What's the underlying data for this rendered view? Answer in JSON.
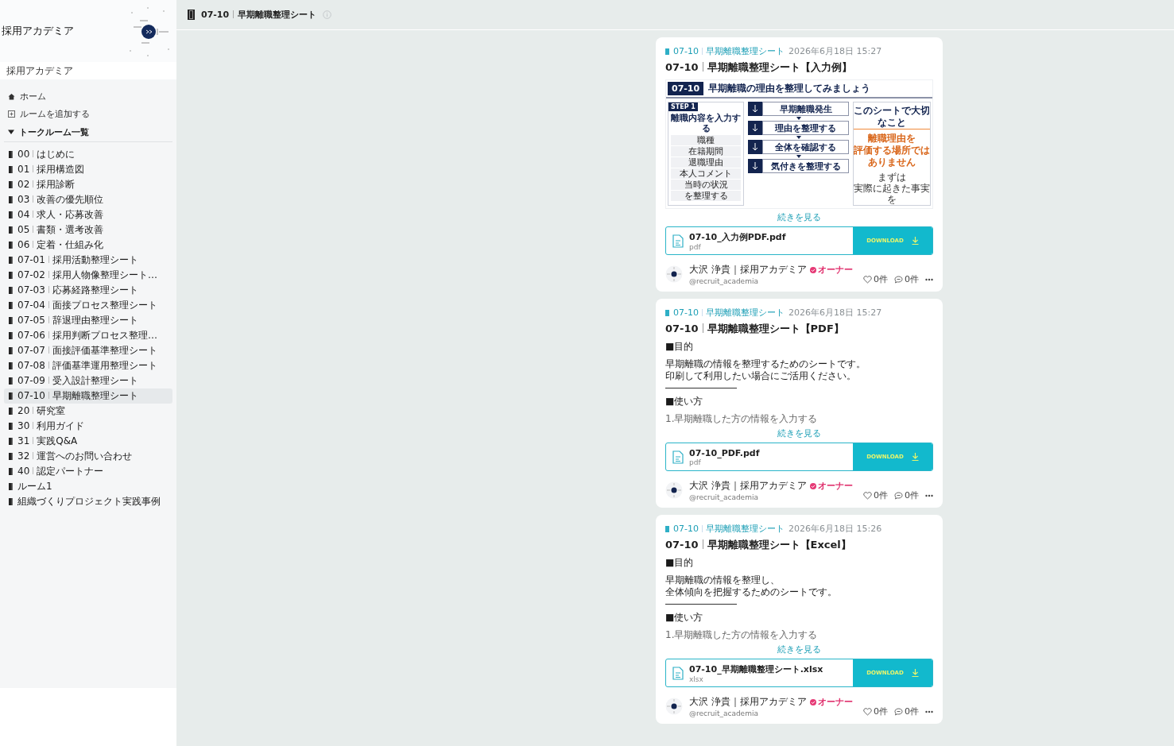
{
  "sidebar": {
    "banner_title": "採用アカデミア",
    "community_name": "採用アカデミア",
    "nav": [
      {
        "kind": "home",
        "label": "ホーム"
      },
      {
        "kind": "add",
        "label": "ルームを追加する"
      }
    ],
    "rooms_section": {
      "label": "トークルーム一覧",
      "expanded": true
    },
    "rooms": [
      {
        "number": "00",
        "name": "はじめに",
        "selected": false
      },
      {
        "number": "01",
        "name": "採用構造図",
        "selected": false
      },
      {
        "number": "02",
        "name": "採用診断",
        "selected": false
      },
      {
        "number": "03",
        "name": "改善の優先順位",
        "selected": false
      },
      {
        "number": "04",
        "name": "求人・応募改善",
        "selected": false
      },
      {
        "number": "05",
        "name": "書類・選考改善",
        "selected": false
      },
      {
        "number": "06",
        "name": "定着・仕組み化",
        "selected": false
      },
      {
        "number": "07-01",
        "name": "採用活動整理シート",
        "selected": false
      },
      {
        "number": "07-02",
        "name": "採用人物像整理シート…",
        "selected": false
      },
      {
        "number": "07-03",
        "name": "応募経路整理シート",
        "selected": false
      },
      {
        "number": "07-04",
        "name": "面接プロセス整理シート",
        "selected": false
      },
      {
        "number": "07-05",
        "name": "辞退理由整理シート",
        "selected": false
      },
      {
        "number": "07-06",
        "name": "採用判断プロセス整理…",
        "selected": false
      },
      {
        "number": "07-07",
        "name": "面接評価基準整理シート",
        "selected": false
      },
      {
        "number": "07-08",
        "name": "評価基準運用整理シート",
        "selected": false
      },
      {
        "number": "07-09",
        "name": "受入設計整理シート",
        "selected": false
      },
      {
        "number": "07-10",
        "name": "早期離職整理シート",
        "selected": true
      },
      {
        "number": "20",
        "name": "研究室",
        "selected": false
      },
      {
        "number": "30",
        "name": "利用ガイド",
        "selected": false
      },
      {
        "number": "31",
        "name": "実践Q&A",
        "selected": false
      },
      {
        "number": "32",
        "name": "運営へのお問い合わせ",
        "selected": false
      },
      {
        "number": "40",
        "name": "認定パートナー",
        "selected": false
      },
      {
        "name": "ルーム1",
        "selected": false
      },
      {
        "name": "組織づくりプロジェクト実践事例",
        "selected": false
      }
    ]
  },
  "header": {
    "number": "07-10",
    "name": "早期離職整理シート"
  },
  "posts": [
    {
      "room_number": "07-10",
      "room_name": "早期離職整理シート",
      "date": "2026年6月18日 15:27",
      "title_number": "07-10",
      "title": "早期離職整理シート【入力例】",
      "body": {
        "kind": "preview",
        "number": "07-10",
        "heading": "早期離職の理由を整理してみましょう",
        "step": {
          "tag": "STEP 1",
          "title": "離職内容を入力する",
          "items": [
            "職種",
            "在籍期間",
            "退職理由",
            "本人コメント",
            "当時の状況",
            "を整理する"
          ]
        },
        "flow": [
          "早期離職発生",
          "理由を整理する",
          "全体を確認する",
          "気付きを整理する"
        ],
        "note": {
          "title": "このシートで大切なこと",
          "emphasis": [
            "離職理由を",
            "評価する場所では",
            "ありません"
          ],
          "lines": [
            "まずは",
            "実際に起きた事実を"
          ]
        }
      },
      "more": "続きを見る",
      "file": {
        "name": "07-10_入力例PDF.pdf",
        "ext": "pdf",
        "button": "DOWNLOAD"
      },
      "author": {
        "name": "大沢 浄貴｜採用アカデミア",
        "badge": "オーナー",
        "handle": "@recruit_academia"
      },
      "likes": "0件",
      "comments": "0件"
    },
    {
      "room_number": "07-10",
      "room_name": "早期離職整理シート",
      "date": "2026年6月18日 15:27",
      "title_number": "07-10",
      "title": "早期離職整理シート【PDF】",
      "body": {
        "kind": "text",
        "blocks": [
          {
            "kind": "paragraph",
            "lines": [
              "■目的"
            ]
          },
          {
            "kind": "paragraph",
            "lines": [
              "早期離職の情報を整理するためのシートです。",
              "印刷して利用したい場合にご活用ください。"
            ]
          },
          {
            "kind": "rule"
          },
          {
            "kind": "paragraph",
            "lines": [
              "■使い方"
            ]
          },
          {
            "kind": "paragraph",
            "lines": [
              "1.早期離職した方の情報を入力する"
            ]
          }
        ]
      },
      "more": "続きを見る",
      "file": {
        "name": "07-10_PDF.pdf",
        "ext": "pdf",
        "button": "DOWNLOAD"
      },
      "author": {
        "name": "大沢 浄貴｜採用アカデミア",
        "badge": "オーナー",
        "handle": "@recruit_academia"
      },
      "likes": "0件",
      "comments": "0件"
    },
    {
      "room_number": "07-10",
      "room_name": "早期離職整理シート",
      "date": "2026年6月18日 15:26",
      "title_number": "07-10",
      "title": "早期離職整理シート【Excel】",
      "body": {
        "kind": "text",
        "blocks": [
          {
            "kind": "paragraph",
            "lines": [
              "■目的"
            ]
          },
          {
            "kind": "paragraph",
            "lines": [
              "早期離職の情報を整理し、",
              "全体傾向を把握するためのシートです。"
            ]
          },
          {
            "kind": "rule"
          },
          {
            "kind": "paragraph",
            "lines": [
              "■使い方"
            ]
          },
          {
            "kind": "paragraph",
            "lines": [
              "1.早期離職した方の情報を入力する"
            ]
          }
        ]
      },
      "more": "続きを見る",
      "file": {
        "name": "07-10_早期離職整理シート.xlsx",
        "ext": "xlsx",
        "button": "DOWNLOAD"
      },
      "author": {
        "name": "大沢 浄貴｜採用アカデミア",
        "badge": "オーナー",
        "handle": "@recruit_academia"
      },
      "likes": "0件",
      "comments": "0件"
    }
  ]
}
